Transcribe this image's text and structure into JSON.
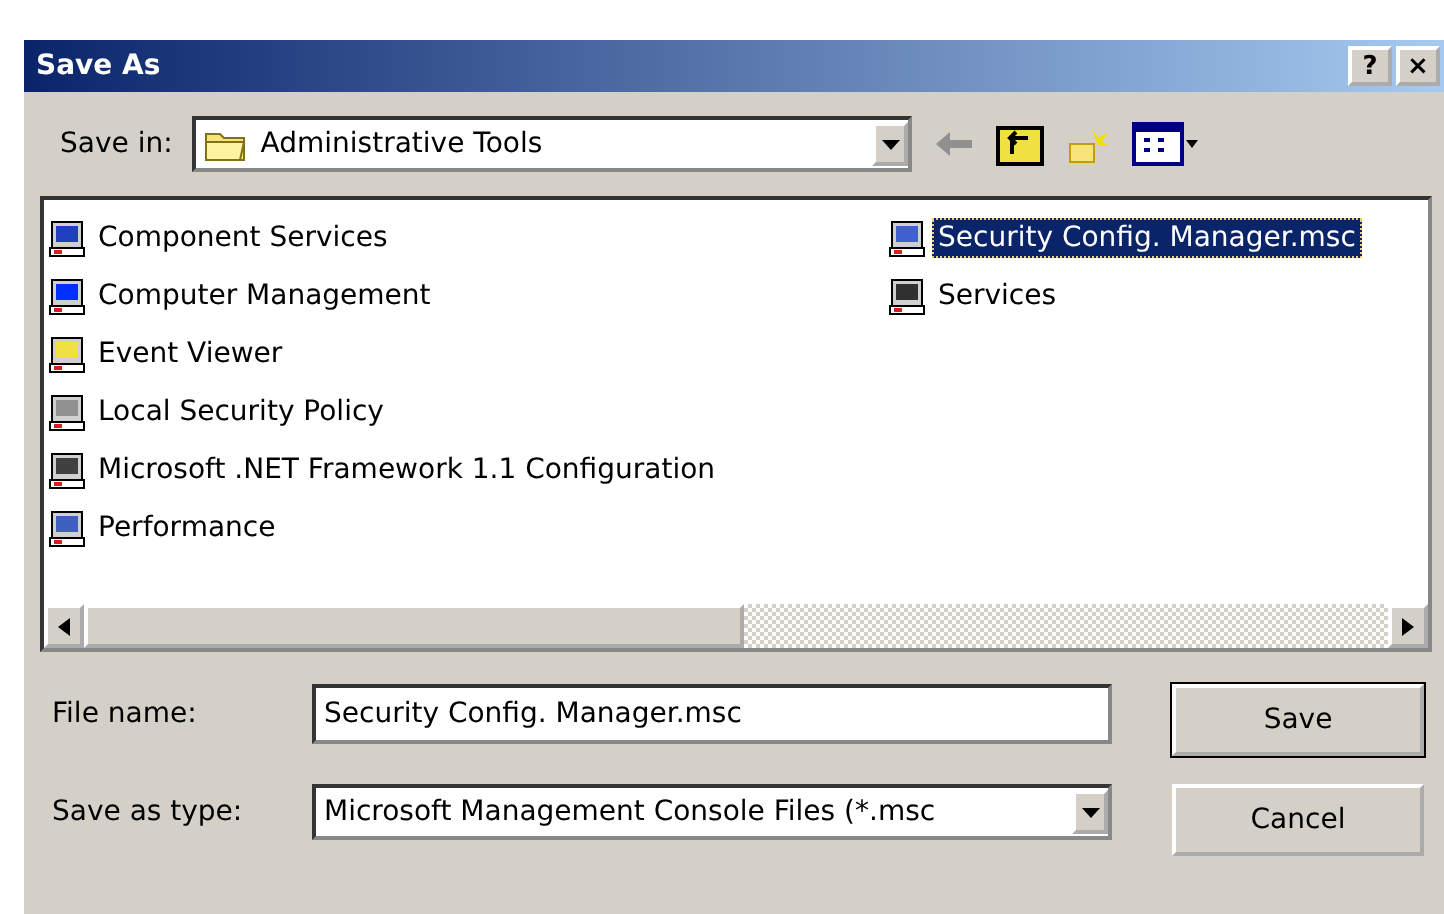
{
  "window": {
    "title": "Save As",
    "help_button": "?",
    "close_button": "×"
  },
  "save_in": {
    "label": "Save in:",
    "value": "Administrative Tools"
  },
  "files": [
    {
      "name": "Component Services",
      "selected": false
    },
    {
      "name": "Computer Management",
      "selected": false
    },
    {
      "name": "Event Viewer",
      "selected": false
    },
    {
      "name": "Local Security Policy",
      "selected": false
    },
    {
      "name": "Microsoft .NET Framework 1.1 Configuration",
      "selected": false
    },
    {
      "name": "Performance",
      "selected": false
    },
    {
      "name": "Security Config. Manager.msc",
      "selected": true
    },
    {
      "name": "Services",
      "selected": false
    }
  ],
  "file_name": {
    "label": "File name:",
    "value": "Security Config. Manager.msc"
  },
  "save_as_type": {
    "label": "Save as type:",
    "value": "Microsoft Management Console Files (*.msc"
  },
  "buttons": [
    {
      "label": "Save",
      "default": true
    },
    {
      "label": "Cancel",
      "default": false
    }
  ]
}
